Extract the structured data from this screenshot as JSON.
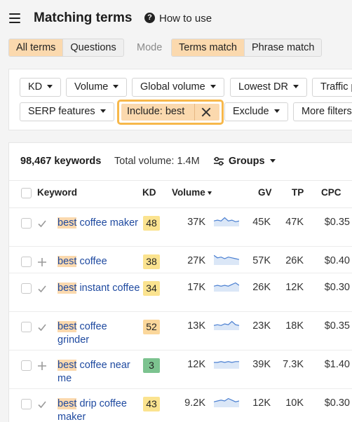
{
  "header": {
    "title": "Matching terms",
    "help_icon": "?",
    "help_label": "How to use"
  },
  "tabs": [
    "All terms",
    "Questions"
  ],
  "mode": {
    "label": "Mode",
    "options": [
      "Terms match",
      "Phrase match"
    ]
  },
  "filters": {
    "kd": "KD",
    "volume": "Volume",
    "global_volume": "Global volume",
    "lowest_dr": "Lowest DR",
    "traffic": "Traffic p",
    "serp": "SERP features",
    "include": "Include: best",
    "exclude": "Exclude",
    "more": "More filters"
  },
  "summary": {
    "count": "98,467 keywords",
    "total_volume": "Total volume: 1.4M",
    "groups": "Groups"
  },
  "columns": {
    "keyword": "Keyword",
    "kd": "KD",
    "volume": "Volume",
    "gv": "GV",
    "tp": "TP",
    "cpc": "CPC"
  },
  "colors": {
    "kd_yellow": "#fbe38f",
    "kd_orange": "#fbd79b",
    "kd_green": "#7cc38f",
    "accent": "#f7b84b",
    "link": "#1f4aa0"
  },
  "rows": [
    {
      "icon": "check-icon",
      "hl": "best",
      "rest": " coffee maker",
      "kd": "48",
      "kd_color": "#fbe38f",
      "volume": "37K",
      "gv": "45K",
      "tp": "47K",
      "cpc": "$0.35",
      "trend": [
        5,
        6,
        5,
        9,
        5,
        6,
        4,
        5
      ]
    },
    {
      "icon": "plus-icon",
      "hl": "best",
      "rest": " coffee",
      "kd": "38",
      "kd_color": "#fbe38f",
      "volume": "27K",
      "gv": "57K",
      "tp": "26K",
      "cpc": "$0.40",
      "trend": [
        10,
        7,
        8,
        6,
        8,
        7,
        6,
        5
      ]
    },
    {
      "icon": "check-icon",
      "hl": "best",
      "rest": " instant coffee",
      "kd": "34",
      "kd_color": "#fbe38f",
      "volume": "17K",
      "gv": "26K",
      "tp": "12K",
      "cpc": "$0.30",
      "trend": [
        5,
        6,
        5,
        6,
        5,
        7,
        9,
        6
      ]
    },
    {
      "icon": "check-icon",
      "hl": "best",
      "rest": " coffee grinder",
      "kd": "52",
      "kd_color": "#fbd79b",
      "volume": "13K",
      "gv": "23K",
      "tp": "18K",
      "cpc": "$0.35",
      "trend": [
        4,
        5,
        4,
        6,
        5,
        9,
        5,
        4
      ]
    },
    {
      "icon": "plus-icon",
      "hl": "best",
      "rest": " coffee near me",
      "kd": "3",
      "kd_color": "#7cc38f",
      "volume": "12K",
      "gv": "39K",
      "tp": "7.3K",
      "cpc": "$1.40",
      "trend": [
        6,
        6,
        7,
        6,
        7,
        6,
        7,
        7
      ]
    },
    {
      "icon": "check-icon",
      "hl": "best",
      "rest": " drip coffee maker",
      "kd": "43",
      "kd_color": "#fbe38f",
      "volume": "9.2K",
      "gv": "12K",
      "tp": "10K",
      "cpc": "$0.30",
      "trend": [
        5,
        6,
        7,
        6,
        9,
        7,
        5,
        6
      ]
    }
  ]
}
